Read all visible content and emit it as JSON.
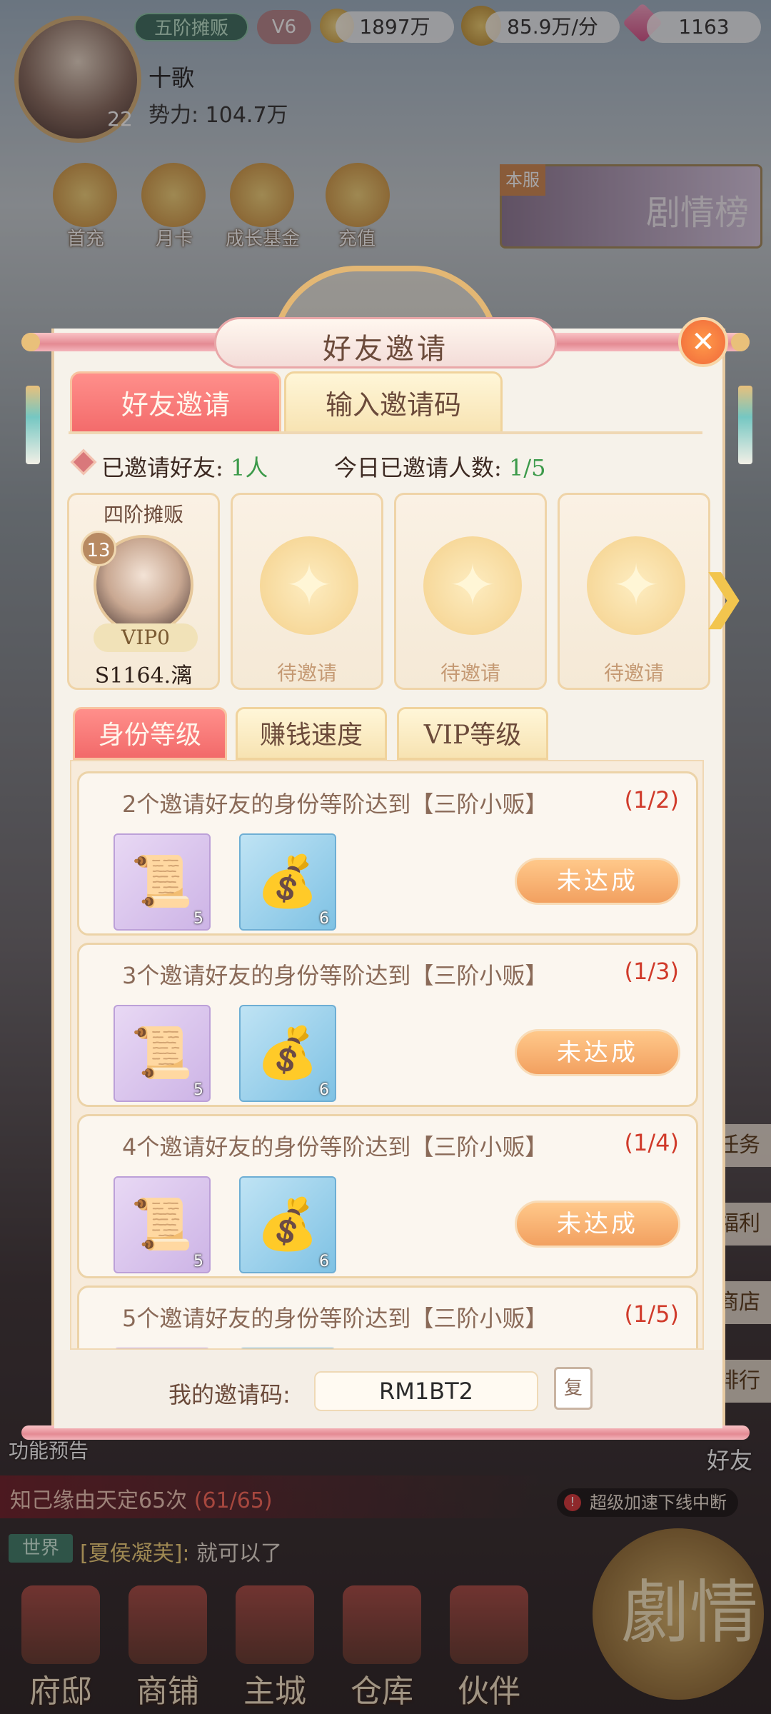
{
  "header": {
    "rank": "五阶摊贩",
    "vip": "V6",
    "avatar_level": "22",
    "name": "十歌",
    "power": "势力: 104.7万",
    "resources": {
      "silver": "1897万",
      "income": "85.9万/分",
      "gems": "1163"
    }
  },
  "top_menu": [
    "首充",
    "月卡",
    "成长基金",
    "充值"
  ],
  "drama_banner": {
    "tag": "本服",
    "label": "剧情榜"
  },
  "side_buttons": [
    "任务",
    "福利",
    "商店",
    "排行"
  ],
  "modal": {
    "title": "好友邀请",
    "tabs": {
      "active": "好友邀请",
      "inactive": "输入邀请码"
    },
    "stats": {
      "invited_label": "已邀请好友:",
      "invited_value": "1人",
      "today_label": "今日已邀请人数:",
      "today_value": "1/5"
    },
    "friends": [
      {
        "rank": "四阶摊贩",
        "level": "13",
        "vip": "VIP0",
        "server": "S1164.漓"
      }
    ],
    "pending_label": "待邀请",
    "sub_tabs": [
      "身份等级",
      "赚钱速度",
      "VIP等级"
    ],
    "tasks": [
      {
        "text": "2个邀请好友的身份等阶达到【三阶小贩】",
        "progress": "(1/2)",
        "item1_count": "5",
        "item2_count": "6",
        "status": "未达成"
      },
      {
        "text": "3个邀请好友的身份等阶达到【三阶小贩】",
        "progress": "(1/3)",
        "item1_count": "5",
        "item2_count": "6",
        "status": "未达成"
      },
      {
        "text": "4个邀请好友的身份等阶达到【三阶小贩】",
        "progress": "(1/4)",
        "item1_count": "5",
        "item2_count": "6",
        "status": "未达成"
      },
      {
        "text": "5个邀请好友的身份等阶达到【三阶小贩】",
        "progress": "(1/5)"
      }
    ],
    "my_code_label": "我的邀请码:",
    "my_code": "RM1BT2",
    "copy_label": "复"
  },
  "bottom": {
    "feature_preview": "功能预告",
    "fate_text": "知己缘由天定65次",
    "fate_count": "(61/65)",
    "speed_note": "超级加速下线中断",
    "friend_entry": "好友",
    "chat": {
      "channel": "世界",
      "user": "[夏侯凝芙]:",
      "message": " 就可以了"
    },
    "drama_label": "劇情",
    "nav": [
      "府邸",
      "商铺",
      "主城",
      "仓库",
      "伙伴"
    ]
  }
}
